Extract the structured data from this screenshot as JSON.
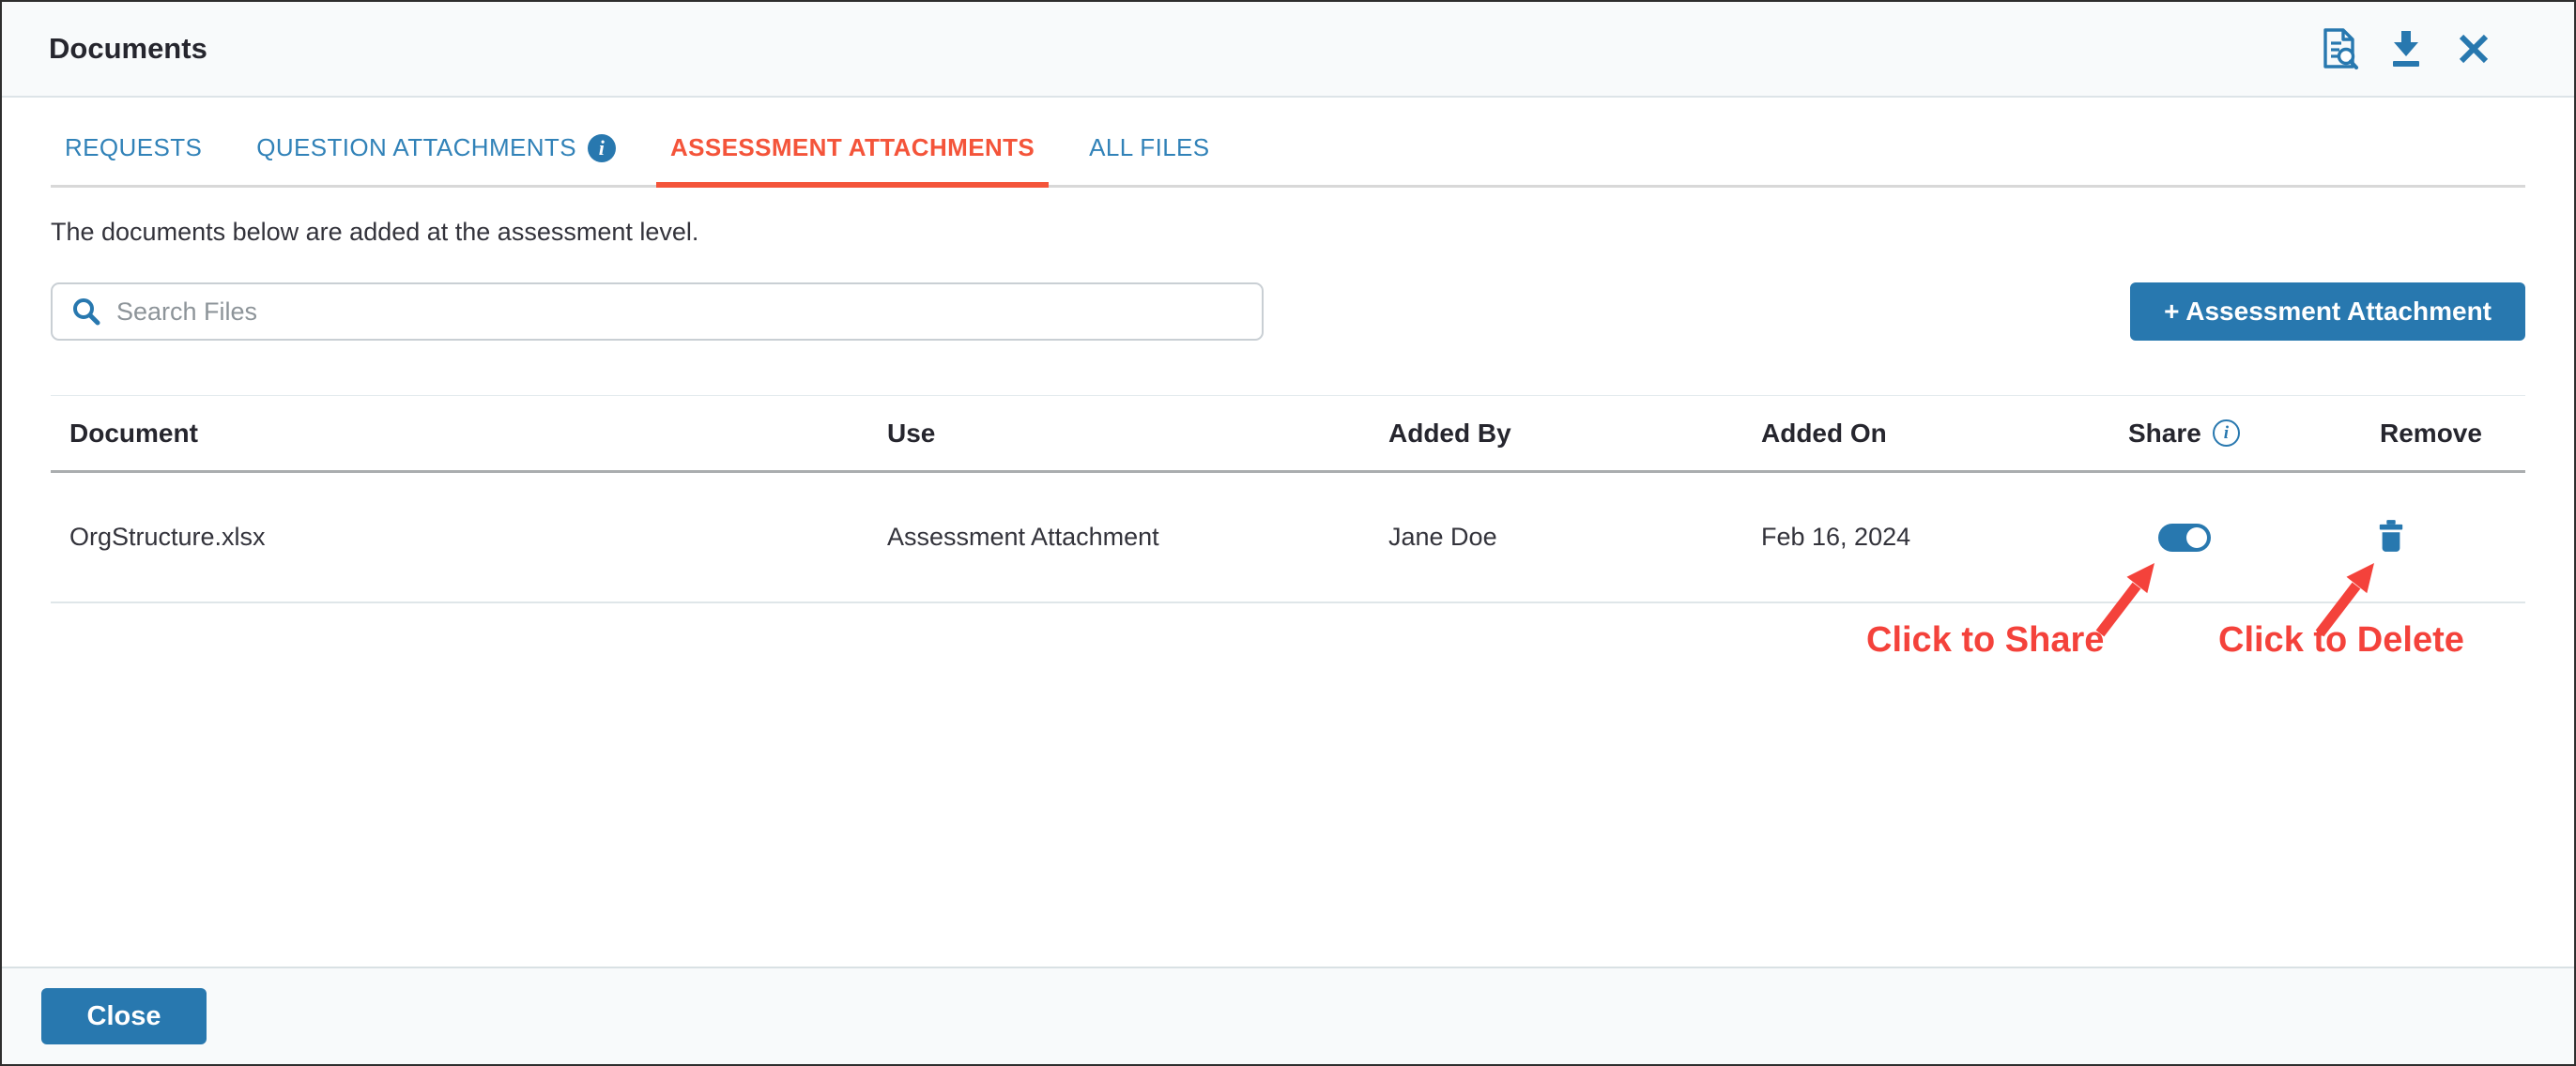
{
  "window": {
    "title": "Documents"
  },
  "tabs": [
    {
      "label": "REQUESTS",
      "active": false
    },
    {
      "label": "QUESTION ATTACHMENTS",
      "active": false,
      "info_icon": "i"
    },
    {
      "label": "ASSESSMENT ATTACHMENTS",
      "active": true
    },
    {
      "label": "ALL FILES",
      "active": false
    }
  ],
  "description": "The documents below are added at the assessment level.",
  "search": {
    "placeholder": "Search Files"
  },
  "toolbar": {
    "add_button_label": "+ Assessment Attachment"
  },
  "table": {
    "columns": [
      "Document",
      "Use",
      "Added By",
      "Added On",
      "Share",
      "Remove"
    ],
    "share_info_icon": "i",
    "rows": [
      {
        "document": "OrgStructure.xlsx",
        "use": "Assessment Attachment",
        "added_by": "Jane Doe",
        "added_on": "Feb 16, 2024",
        "share_state": "on"
      }
    ]
  },
  "annotations": {
    "share_label": "Click to Share",
    "delete_label": "Click to Delete"
  },
  "footer": {
    "close_label": "Close"
  },
  "colors": {
    "accent_blue": "#2878af",
    "tab_blue": "#3182b8",
    "active_tab_orange": "#f4543a",
    "annotation_red": "#f4423b"
  }
}
